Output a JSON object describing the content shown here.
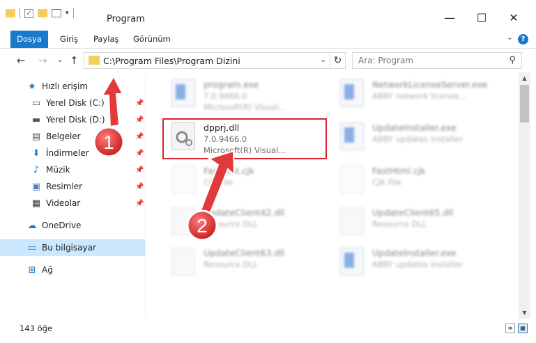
{
  "window": {
    "title": "Program",
    "minimize_label": "—",
    "maximize_label": "☐",
    "close_label": "✕"
  },
  "ribbon": {
    "tabs": [
      "Dosya",
      "Giriş",
      "Paylaş",
      "Görünüm"
    ],
    "collapse_glyph": "⌄",
    "help_glyph": "?"
  },
  "navigation": {
    "back_glyph": "←",
    "forward_glyph": "→",
    "recent_glyph": "⌄",
    "up_glyph": "↑",
    "address_path": "C:\\Program Files\\Program Dizini",
    "dropdown_glyph": "⌄",
    "refresh_glyph": "↻",
    "search_placeholder": "Ara: Program",
    "search_glyph": "⚲"
  },
  "sidebar": {
    "pin_glyph": "📌",
    "items": [
      {
        "label": "Hızlı erişim",
        "icon": "star-icon",
        "glyph": "★",
        "color": "#1979ca",
        "pinned": false
      },
      {
        "label": "Yerel Disk (C:)",
        "icon": "drive-icon",
        "glyph": "▭",
        "color": "#555555",
        "pinned": true
      },
      {
        "label": "Yerel Disk (D:)",
        "icon": "drive-icon",
        "glyph": "▬",
        "color": "#555555",
        "pinned": true
      },
      {
        "label": "Belgeler",
        "icon": "documents-icon",
        "glyph": "▤",
        "color": "#555555",
        "pinned": true
      },
      {
        "label": "İndirmeler",
        "icon": "downloads-icon",
        "glyph": "⬇",
        "color": "#1979ca",
        "pinned": true
      },
      {
        "label": "Müzik",
        "icon": "music-icon",
        "glyph": "♪",
        "color": "#1979ca",
        "pinned": true
      },
      {
        "label": "Resimler",
        "icon": "pictures-icon",
        "glyph": "▣",
        "color": "#4a7fbf",
        "pinned": true
      },
      {
        "label": "Videolar",
        "icon": "videos-icon",
        "glyph": "▦",
        "color": "#333333",
        "pinned": true
      },
      {
        "label": "OneDrive",
        "icon": "cloud-icon",
        "glyph": "☁",
        "color": "#1979ca",
        "pinned": false
      },
      {
        "label": "Bu bilgisayar",
        "icon": "computer-icon",
        "glyph": "▭",
        "color": "#1979ca",
        "pinned": false,
        "selected": true
      },
      {
        "label": "Ağ",
        "icon": "network-icon",
        "glyph": "⊞",
        "color": "#1979ca",
        "pinned": false
      }
    ]
  },
  "files": [
    {
      "name": "program.exe",
      "line2": "7.0.9466.0",
      "line3": "Microsoft(R) Visual...",
      "icon": "exe-file-icon",
      "blurred": true
    },
    {
      "name": "NetworkLicenseServer.exe",
      "line2": "ABBY network license...",
      "line3": "",
      "icon": "exe-file-icon",
      "blurred": true
    },
    {
      "name": "dpprj.dll",
      "line2": "7.0.9466.0",
      "line3": "Microsoft(R) Visual...",
      "icon": "dll-file-icon",
      "blurred": false,
      "highlighted": true
    },
    {
      "name": "UpdateInstaller.exe",
      "line2": "ABBY updates installer",
      "line3": "",
      "icon": "exe-file-icon",
      "blurred": true
    },
    {
      "name": "FastFirst.cjk",
      "line2": "CJK File",
      "line3": "",
      "icon": "page-file-icon",
      "blurred": true
    },
    {
      "name": "FastHtml.cjk",
      "line2": "CJK File",
      "line3": "",
      "icon": "page-file-icon",
      "blurred": true
    },
    {
      "name": "UpdateClient42.dll",
      "line2": "Resource DLL",
      "line3": "",
      "icon": "dll-file-icon",
      "blurred": true
    },
    {
      "name": "UpdateClient65.dll",
      "line2": "Resource DLL",
      "line3": "",
      "icon": "dll-file-icon",
      "blurred": true
    },
    {
      "name": "UpdateClient63.dll",
      "line2": "Resource DLL",
      "line3": "",
      "icon": "dll-file-icon",
      "blurred": true
    },
    {
      "name": "UpdateInstaller.exe",
      "line2": "ABBY updates installer",
      "line3": "",
      "icon": "exe-file-icon",
      "blurred": true
    }
  ],
  "annotations": [
    {
      "label": "1",
      "color": "#e23a3a"
    },
    {
      "label": "2",
      "color": "#e23a3a"
    }
  ],
  "status": {
    "item_count": "143 öğe"
  },
  "scrollbar": {
    "up_glyph": "▲",
    "down_glyph": "▼"
  }
}
